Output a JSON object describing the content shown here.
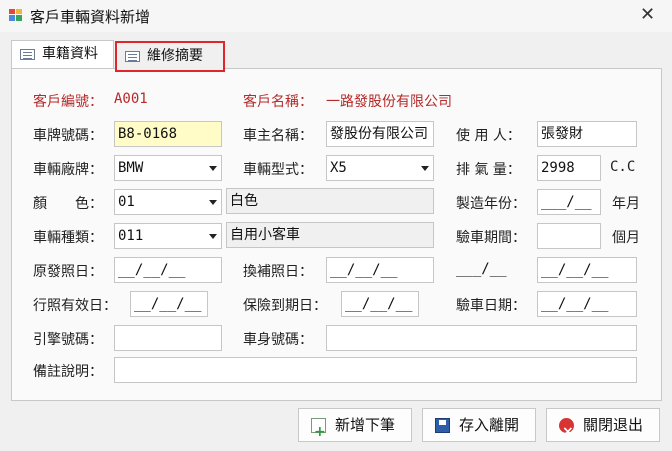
{
  "window": {
    "title": "客戶車輛資料新增",
    "close_glyph": "✕",
    "icon": "app-form-icon"
  },
  "tabs": [
    {
      "label": "車籍資料",
      "active": true
    },
    {
      "label": "維修摘要",
      "active": false
    }
  ],
  "customer": {
    "id_label": "客戶編號：",
    "id_value": "A001",
    "name_label": "客戶名稱：",
    "name_value": "一路發股份有限公司"
  },
  "fields": {
    "plate": {
      "label": "車牌號碼：",
      "value": "B8-0168"
    },
    "owner": {
      "label": "車主名稱：",
      "value": "發股份有限公司"
    },
    "user": {
      "label": "使 用 人：",
      "value": "張發財"
    },
    "brand": {
      "label": "車輛廠牌：",
      "value": "BMW"
    },
    "model": {
      "label": "車輛型式：",
      "value": "X5"
    },
    "displacement": {
      "label": "排 氣 量：",
      "value": "2998",
      "unit": "C.C"
    },
    "color": {
      "label": "顏　　色：",
      "code": "01",
      "name": "白色"
    },
    "mfg_year": {
      "label": "製造年份：",
      "value": "___/__",
      "unit": "年月"
    },
    "category": {
      "label": "車輛種類：",
      "code": "011",
      "name": "自用小客車"
    },
    "inspection_period": {
      "label": "驗車期間：",
      "value": "",
      "unit": "個月"
    },
    "original_license": {
      "label": "原發照日：",
      "value": "__/__/__"
    },
    "reissue_license": {
      "label": "換補照日：",
      "value": "__/__/__"
    },
    "extra_a": {
      "value": "___/__"
    },
    "extra_b": {
      "value": "__/__/__"
    },
    "license_expiry": {
      "label": "行照有效日：",
      "value": "__/__/__"
    },
    "insurance_expiry": {
      "label": "保險到期日：",
      "value": "__/__/__"
    },
    "inspection_date": {
      "label": "驗車日期：",
      "value": "__/__/__"
    },
    "engine_no": {
      "label": "引擎號碼：",
      "value": ""
    },
    "body_no": {
      "label": "車身號碼：",
      "value": ""
    },
    "remarks": {
      "label": "備註說明：",
      "value": ""
    }
  },
  "buttons": {
    "add_next": "新增下筆",
    "save_leave": "存入離開",
    "close_exit": "關閉退出"
  },
  "colors": {
    "highlight_border": "#e0262b",
    "label_red": "#b52a2a",
    "plate_bg": "#fffcc8"
  }
}
